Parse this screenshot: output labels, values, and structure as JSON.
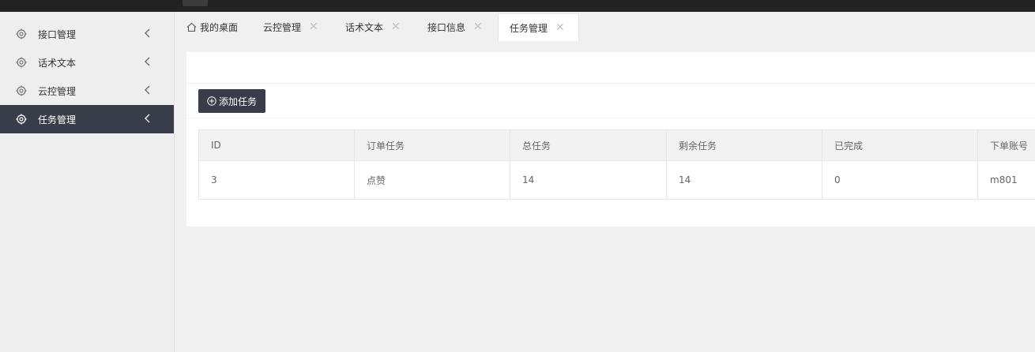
{
  "sidebar": {
    "items": [
      {
        "label": "接口管理",
        "active": false
      },
      {
        "label": "话术文本",
        "active": false
      },
      {
        "label": "云控管理",
        "active": false
      },
      {
        "label": "任务管理",
        "active": true
      }
    ]
  },
  "tabs": [
    {
      "label": "我的桌面",
      "closable": false,
      "icon": "home-icon"
    },
    {
      "label": "云控管理",
      "closable": true
    },
    {
      "label": "话术文本",
      "closable": true
    },
    {
      "label": "接口信息",
      "closable": true
    },
    {
      "label": "任务管理",
      "closable": true,
      "active": true
    }
  ],
  "tab_close_glyph": "✕",
  "toolbar": {
    "add_label": "添加任务"
  },
  "table": {
    "headers": [
      "ID",
      "订单任务",
      "总任务",
      "剩余任务",
      "已完成",
      "下单账号"
    ],
    "rows": [
      [
        "3",
        "点赞",
        "14",
        "14",
        "0",
        "m801"
      ]
    ]
  },
  "colors": {
    "active_bg": "#393d49",
    "topbar": "#222222",
    "page_bg": "#f0f0f0"
  }
}
